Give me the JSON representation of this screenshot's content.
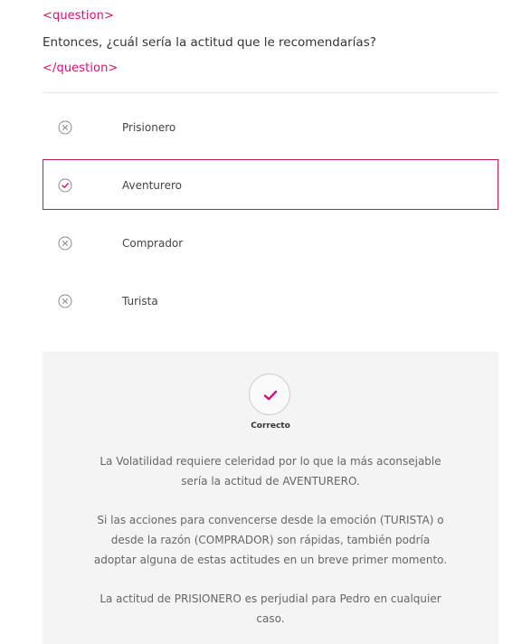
{
  "question": {
    "open_tag": "<question>",
    "text": "Entonces, ¿cuál sería la actitud que le recomendarías?",
    "close_tag": "</question>"
  },
  "options": [
    {
      "label": "Prisionero",
      "icon": "x-circle-icon",
      "selected": false
    },
    {
      "label": "Aventurero",
      "icon": "check-circle-icon",
      "selected": true
    },
    {
      "label": "Comprador",
      "icon": "x-circle-icon",
      "selected": false
    },
    {
      "label": "Turista",
      "icon": "x-circle-icon",
      "selected": false
    }
  ],
  "feedback": {
    "status": "Correcto",
    "icon": "check-icon",
    "paragraphs": [
      "La Volatilidad requiere celeridad por lo que la más aconsejable sería la actitud de AVENTURERO.",
      "Si las acciones para convencerse desde la emoción (TURISTA) o desde la razón (COMPRADOR) son rápidas, también podría adoptar alguna de estas actitudes en un breve primer momento.",
      "La actitud de PRISIONERO es perjudial para Pedro en cualquier caso."
    ]
  },
  "colors": {
    "accent": "#d1127a",
    "selected_border": "#c2185b",
    "feedback_bg": "#f4f4f4",
    "text": "#333333",
    "muted_text": "#666666"
  }
}
